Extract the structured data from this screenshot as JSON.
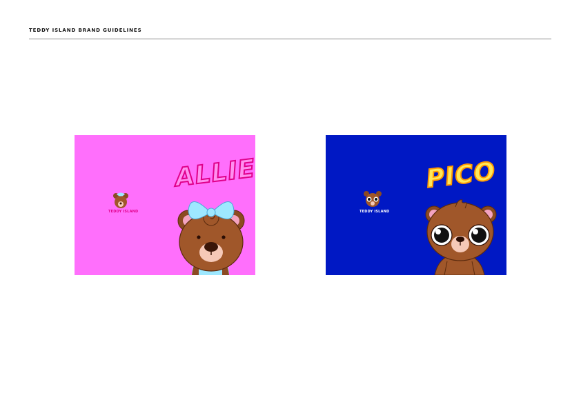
{
  "header": {
    "title": "TEDDY ISLAND BRAND GUIDELINES"
  },
  "cards": [
    {
      "character_name": "ALLIE",
      "brand_name": "TEDDY ISLAND",
      "colors": {
        "background": "#ff6ffc",
        "name_fill": "#ff8ff0",
        "name_outline": "#e0008a",
        "brand_text": "#e0008a",
        "bow": "#9ee8ff"
      }
    },
    {
      "character_name": "PICO",
      "brand_name": "TEDDY ISLAND",
      "colors": {
        "background": "#0018c4",
        "name_fill": "#ffe85a",
        "name_outline": "#ff9a00",
        "brand_text": "#ffffff"
      }
    }
  ]
}
